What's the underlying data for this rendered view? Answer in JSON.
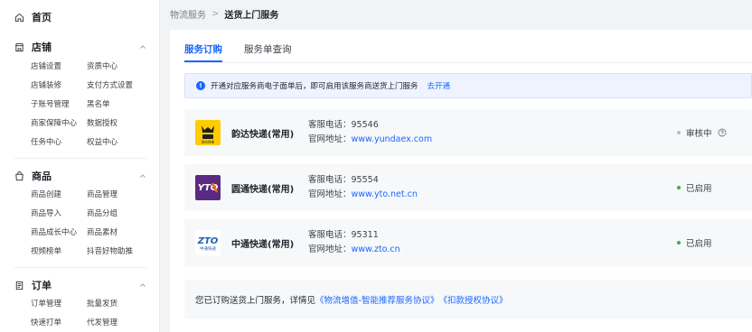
{
  "sidebar": {
    "home": {
      "label": "首页",
      "icon": "home-icon"
    },
    "sections": [
      {
        "title": "店铺",
        "icon": "store-icon",
        "items": [
          "店铺设置",
          "资质中心",
          "店铺装修",
          "支付方式设置",
          "子账号管理",
          "黑名单",
          "商家保障中心",
          "数据授权",
          "任务中心",
          "权益中心"
        ]
      },
      {
        "title": "商品",
        "icon": "goods-icon",
        "items": [
          "商品创建",
          "商品管理",
          "商品导入",
          "商品分组",
          "商品成长中心",
          "商品素材",
          "视频榜单",
          "抖音好物助推"
        ]
      },
      {
        "title": "订单",
        "icon": "order-icon",
        "items": [
          "订单管理",
          "批量发货",
          "快速打单",
          "代发管理"
        ]
      }
    ]
  },
  "breadcrumb": {
    "parent": "物流服务",
    "separator": ">",
    "current": "送货上门服务"
  },
  "tabs": [
    {
      "label": "服务订购",
      "active": true
    },
    {
      "label": "服务单查询",
      "active": false
    }
  ],
  "notice": {
    "text": "开通对应服务商电子面单后，即可启用该服务商送货上门服务",
    "link": "去开通"
  },
  "providers": [
    {
      "name": "韵达快递(常用)",
      "phone_label": "客服电话：",
      "phone": "95546",
      "site_label": "官网地址：",
      "site": "www.yundaex.com",
      "status": "审核中",
      "status_color": "#b8bcc3",
      "logo": "yunda-logo",
      "logo_bg": "#ffcc00",
      "logo_text": "韵达快递"
    },
    {
      "name": "圆通快递(常用)",
      "phone_label": "客服电话：",
      "phone": "95554",
      "site_label": "官网地址：",
      "site": "www.yto.net.cn",
      "status": "已启用",
      "status_color": "#2bb45a",
      "logo": "yto-logo",
      "logo_bg": "#5a2a82",
      "logo_text": "YTO"
    },
    {
      "name": "中通快递(常用)",
      "phone_label": "客服电话：",
      "phone": "95311",
      "site_label": "官网地址：",
      "site": "www.zto.cn",
      "status": "已启用",
      "status_color": "#2bb45a",
      "logo": "zto-logo",
      "logo_bg": "#ffffff",
      "logo_text": "中通快递"
    }
  ],
  "agreement": {
    "prefix": "您已订购送货上门服务，详情见",
    "link1": "《物流增值-智能推荐服务协议》",
    "link2": "《扣款授权协议》"
  },
  "colors": {
    "accent": "#1966ff",
    "success": "#2bb45a",
    "pending": "#b8bcc3"
  }
}
